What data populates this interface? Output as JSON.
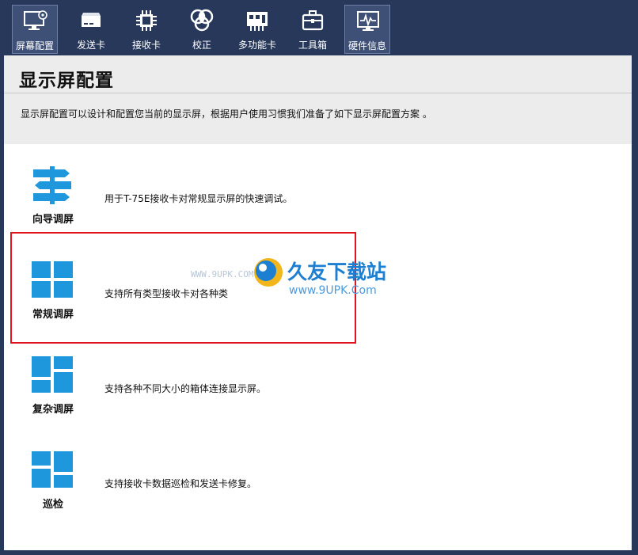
{
  "toolbar": {
    "items": [
      {
        "label": "屏幕配置",
        "icon": "monitor-gear-icon",
        "active": true
      },
      {
        "label": "发送卡",
        "icon": "sender-box-icon",
        "active": false
      },
      {
        "label": "接收卡",
        "icon": "chip-icon",
        "active": false
      },
      {
        "label": "校正",
        "icon": "rgb-circles-icon",
        "active": false
      },
      {
        "label": "多功能卡",
        "icon": "multi-card-icon",
        "active": false
      },
      {
        "label": "工具箱",
        "icon": "toolbox-icon",
        "active": false
      },
      {
        "label": "硬件信息",
        "icon": "pulse-monitor-icon",
        "active": false
      }
    ]
  },
  "page": {
    "title": "显示屏配置",
    "description": "显示屏配置可以设计和配置您当前的显示屏，根据用户使用习惯我们准备了如下显示屏配置方案 。"
  },
  "options": [
    {
      "label": "向导调屏",
      "desc": "用于T-75E接收卡对常规显示屏的快速调试。",
      "icon": "signpost-icon"
    },
    {
      "label": "常规调屏",
      "desc": "支持所有类型接收卡对各种类",
      "icon": "grid-four-icon"
    },
    {
      "label": "复杂调屏",
      "desc": "支持各种不同大小的箱体连接显示屏。",
      "icon": "grid-complex-icon"
    },
    {
      "label": "巡检",
      "desc": "支持接收卡数据巡检和发送卡修复。",
      "icon": "grid-inspect-icon"
    }
  ],
  "watermark": {
    "brand": "久友下载站",
    "url": "www.9UPK.Com",
    "url_left": "WWW.9UPK.COM"
  },
  "colors": {
    "toolbar_bg": "#27385a",
    "accent_blue": "#1f97dc",
    "selection_red": "#e0141e"
  }
}
